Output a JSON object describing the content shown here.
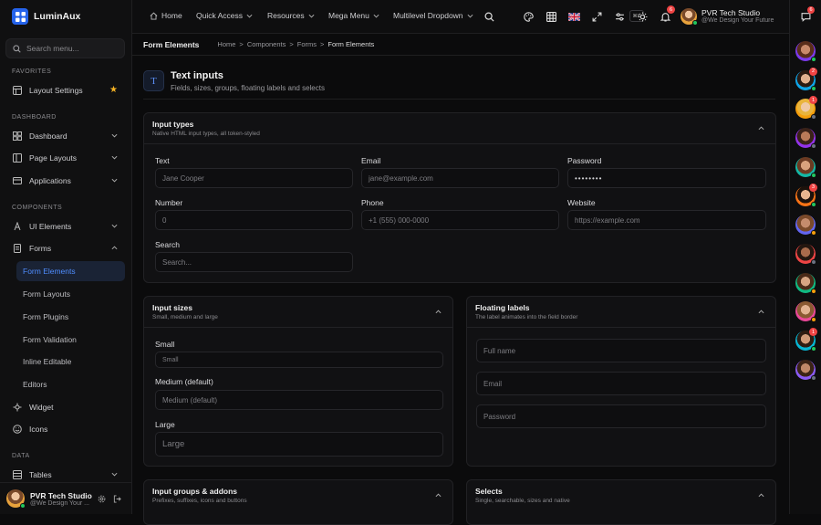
{
  "brand": {
    "name": "LuminAux"
  },
  "sidebar": {
    "search_placeholder": "Search menu...",
    "sections": {
      "favorites": "FAVORITES",
      "dashboard": "DASHBOARD",
      "components": "COMPONENTS",
      "data": "DATA"
    },
    "items": {
      "layout_settings": "Layout Settings",
      "dashboard": "Dashboard",
      "page_layouts": "Page Layouts",
      "applications": "Applications",
      "ui_elements": "UI Elements",
      "forms": "Forms",
      "widget": "Widget",
      "icons": "Icons",
      "tables": "Tables"
    },
    "forms_sub": {
      "form_elements": "Form Elements",
      "form_layouts": "Form Layouts",
      "form_plugins": "Form Plugins",
      "form_validation": "Form Validation",
      "inline_editable": "Inline Editable",
      "editors": "Editors"
    }
  },
  "user": {
    "name": "PVR Tech Studio",
    "tagline_full": "@We Design Your Future",
    "tagline_short": "@We Design Your ..."
  },
  "topbar": {
    "home": "Home",
    "quick_access": "Quick Access",
    "resources": "Resources",
    "mega_menu": "Mega Menu",
    "multilevel": "Multilevel Dropdown",
    "kbd": "⌘K",
    "notifications_count": "6",
    "messages_count": "6"
  },
  "breadcrumb": {
    "title": "Form Elements",
    "home": "Home",
    "components": "Components",
    "forms": "Forms",
    "current": "Form Elements"
  },
  "page": {
    "title": "Text inputs",
    "subtitle": "Fields, sizes, groups, floating labels and selects",
    "icon_letter": "T"
  },
  "input_types": {
    "title": "Input types",
    "subtitle": "Native HTML input types, all token-styled",
    "text_label": "Text",
    "text_placeholder": "Jane Cooper",
    "email_label": "Email",
    "email_placeholder": "jane@example.com",
    "password_label": "Password",
    "password_value": "••••••••",
    "number_label": "Number",
    "number_placeholder": "0",
    "phone_label": "Phone",
    "phone_placeholder": "+1 (555) 000-0000",
    "website_label": "Website",
    "website_placeholder": "https://example.com",
    "search_label": "Search",
    "search_placeholder": "Search..."
  },
  "input_sizes": {
    "title": "Input sizes",
    "subtitle": "Small, medium and large",
    "small_label": "Small",
    "small_placeholder": "Small",
    "medium_label": "Medium (default)",
    "medium_placeholder": "Medium (default)",
    "large_label": "Large",
    "large_placeholder": "Large"
  },
  "floating_labels": {
    "title": "Floating labels",
    "subtitle": "The label animates into the field border",
    "full_name": "Full name",
    "email": "Email",
    "password": "Password"
  },
  "input_groups": {
    "title": "Input groups & addons",
    "subtitle": "Prefixes, suffixes, icons and buttons"
  },
  "selects": {
    "title": "Selects",
    "subtitle": "Single, searchable, sizes and native"
  },
  "right_avatars": [
    {
      "status": "#22c55e",
      "badge": ""
    },
    {
      "status": "#22c55e",
      "badge": "2"
    },
    {
      "status": "#6b7280",
      "badge": "1"
    },
    {
      "status": "#6b7280",
      "badge": ""
    },
    {
      "status": "#22c55e",
      "badge": ""
    },
    {
      "status": "#22c55e",
      "badge": "3"
    },
    {
      "status": "#f59e0b",
      "badge": ""
    },
    {
      "status": "#6b7280",
      "badge": ""
    },
    {
      "status": "#f59e0b",
      "badge": ""
    },
    {
      "status": "#f59e0b",
      "badge": ""
    },
    {
      "status": "#22c55e",
      "badge": "1"
    },
    {
      "status": "#6b7280",
      "badge": ""
    }
  ]
}
